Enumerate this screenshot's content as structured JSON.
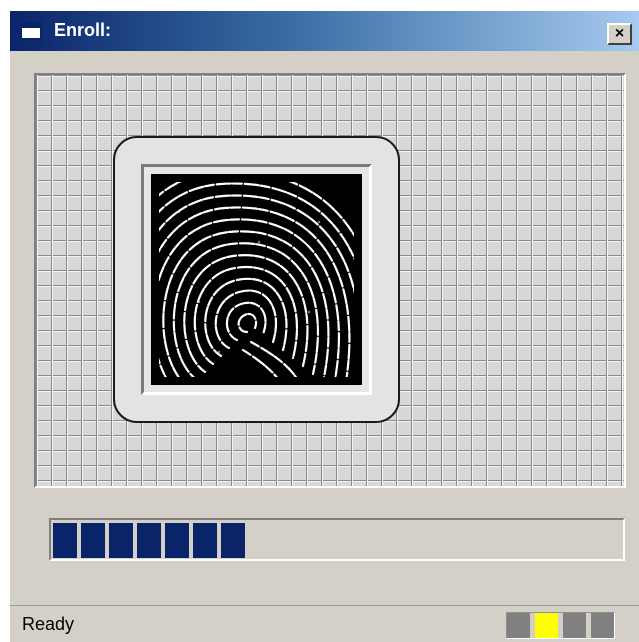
{
  "window": {
    "title": "Enroll:",
    "close_label": "×"
  },
  "capture": {
    "progress_filled_segments": 7,
    "segment_color": "#0a246a"
  },
  "status_bar": {
    "status": "Ready",
    "indicators": [
      {
        "name": "indicator-1",
        "color": "#808080"
      },
      {
        "name": "indicator-2",
        "color": "#ffff00"
      },
      {
        "name": "indicator-3",
        "color": "#808080"
      },
      {
        "name": "indicator-4",
        "color": "#808080"
      }
    ]
  }
}
